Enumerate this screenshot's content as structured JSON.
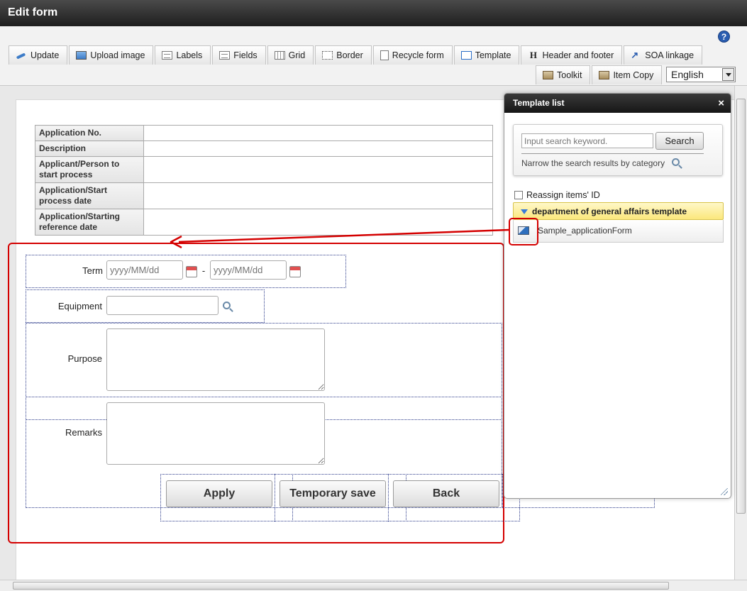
{
  "window": {
    "title": "Edit form"
  },
  "toolbar": {
    "help_label": "?",
    "tabs": [
      {
        "label": "Update",
        "icon": "update-icon"
      },
      {
        "label": "Upload image",
        "icon": "image-icon"
      },
      {
        "label": "Labels",
        "icon": "labels-icon"
      },
      {
        "label": "Fields",
        "icon": "fields-icon"
      },
      {
        "label": "Grid",
        "icon": "grid-icon"
      },
      {
        "label": "Border",
        "icon": "border-icon"
      },
      {
        "label": "Recycle form",
        "icon": "recycle-form-icon"
      },
      {
        "label": "Template",
        "icon": "template-icon"
      },
      {
        "label": "Header and footer",
        "icon": "header-footer-icon"
      },
      {
        "label": "SOA linkage",
        "icon": "soa-linkage-icon"
      }
    ],
    "tabs2": [
      {
        "label": "Toolkit",
        "icon": "toolkit-icon"
      },
      {
        "label": "Item Copy",
        "icon": "item-copy-icon"
      }
    ],
    "language": "English"
  },
  "header_table": {
    "rows": [
      {
        "label": "Application No.",
        "value": ""
      },
      {
        "label": "Description",
        "value": ""
      },
      {
        "label": "Applicant/Person to start process",
        "value": ""
      },
      {
        "label": "Application/Start process date",
        "value": ""
      },
      {
        "label": "Application/Starting reference date",
        "value": ""
      }
    ]
  },
  "form": {
    "term_label": "Term",
    "term_from_placeholder": "yyyy/MM/dd",
    "term_to_placeholder": "yyyy/MM/dd",
    "term_separator": "-",
    "equipment_label": "Equipment",
    "purpose_label": "Purpose",
    "remarks_label": "Remarks",
    "apply_button": "Apply",
    "temp_save_button": "Temporary save",
    "back_button": "Back"
  },
  "template_panel": {
    "title": "Template list",
    "close_label": "×",
    "search_placeholder": "Input search keyword.",
    "search_button": "Search",
    "narrow_text": "Narrow the search results by category",
    "reassign_label": "Reassign items' ID",
    "reassign_checked": false,
    "category": "department of general affairs template",
    "items": [
      {
        "name": "Sample_applicationForm"
      }
    ]
  },
  "colors": {
    "highlight": "#d40000",
    "accent": "#2a5db0"
  }
}
